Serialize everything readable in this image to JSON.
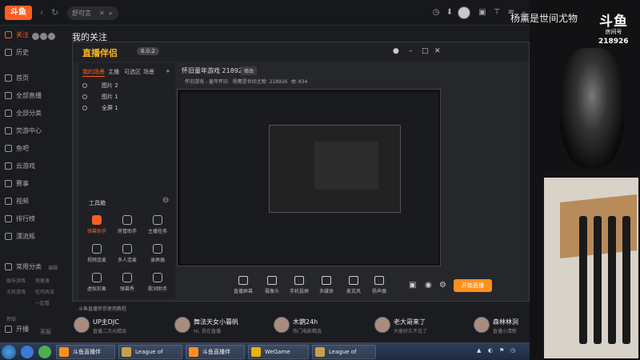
{
  "colors": {
    "accent": "#ff5d23",
    "go_live": "#ff8f1c",
    "bg": "#1b1c20"
  },
  "topbar": {
    "logo": "斗鱼",
    "search_text": "舒可言",
    "icons": [
      "back-icon",
      "refresh-icon",
      "close-icon",
      "search-icon",
      "history-icon",
      "download-icon",
      "avatar",
      "gift-icon",
      "shirt-icon",
      "menu-icon",
      "minimize-icon"
    ]
  },
  "sidebar": {
    "follow_label": "关注",
    "items": [
      "历史",
      "首页",
      "全部直播",
      "全部分类",
      "荧游中心",
      "鱼吧",
      "云游戏",
      "赛事",
      "视频",
      "排行榜",
      "漂流瓶"
    ],
    "common_label": "常用分类",
    "common_edit": "编辑",
    "common_subs": [
      "娱乐游戏",
      "侠客逸",
      "王机游戏",
      "吃鸡风谈",
      "一起看"
    ],
    "bottom": [
      "开播",
      "客服"
    ],
    "new_label": "新版"
  },
  "content": {
    "title": "我的关注"
  },
  "companion": {
    "logo": "直播伴侣",
    "badge": "6.0.2",
    "tabs": [
      "我的场景",
      "主播",
      "可选区",
      "场景"
    ],
    "scenes": [
      "图片 2",
      "图片 1",
      "全屏 1"
    ],
    "tools_title": "工具箱",
    "tools": [
      "弹幕助手",
      "房管助手",
      "主播任务",
      "视频连麦",
      "多人连麦",
      "录屏器",
      "虚拟形象",
      "弹幕秀",
      "歌词助手"
    ],
    "stream_title": "怀旧童年游戏 218926",
    "stream_tag": "修改",
    "stream_sub": "怀旧游戏 - 童年怀旧",
    "stream_owner": "杨薰是世间尤物",
    "stream_id": "218926",
    "viewers": "834",
    "controls": [
      "直播屏幕",
      "摄像头",
      "手机投屏",
      "多媒体",
      "麦克风",
      "扬声器"
    ],
    "go_live": "开始直播"
  },
  "notice": "斗鱼直播伴侣使用教程",
  "recommend": [
    {
      "name": "UP主DJC",
      "desc": "直播二次元精品"
    },
    {
      "name": "舞法天女小暮帆",
      "desc": "Hi, 我在直播"
    },
    {
      "name": "木鹦24h",
      "desc": "热门电影精选"
    },
    {
      "name": "老大哥来了",
      "desc": "大家好久不见了"
    },
    {
      "name": "森林林洞",
      "desc": "直播小清新"
    }
  ],
  "taskbar": {
    "tasks": [
      "斗鱼直播伴",
      "League of Lege...",
      "斗鱼直播伴",
      "WeGame",
      "League of Lege..."
    ]
  },
  "overlay": {
    "streamer_name": "杨薰是世间尤物",
    "logo_top": "斗鱼",
    "logo_sub": "房间号",
    "room_number": "218926"
  }
}
